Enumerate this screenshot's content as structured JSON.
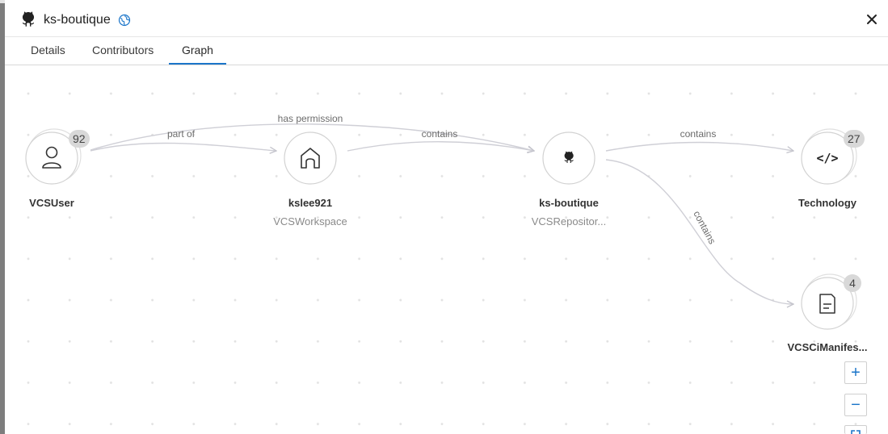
{
  "header": {
    "title": "ks-boutique",
    "repo_icon": "github-octocat-icon",
    "visibility_icon": "globe-icon",
    "close_icon": "close-icon"
  },
  "tabs": [
    {
      "label": "Details",
      "active": false
    },
    {
      "label": "Contributors",
      "active": false
    },
    {
      "label": "Graph",
      "active": true
    }
  ],
  "graph": {
    "nodes": [
      {
        "id": "vcsuser",
        "label": "VCSUser",
        "sublabel": "",
        "badge": "92",
        "icon": "user-icon"
      },
      {
        "id": "kslee921",
        "label": "kslee921",
        "sublabel": "VCSWorkspace",
        "badge": "",
        "icon": "home-icon"
      },
      {
        "id": "ks-boutique",
        "label": "ks-boutique",
        "sublabel": "VCSRepositor...",
        "badge": "",
        "icon": "github-octocat-icon"
      },
      {
        "id": "technology",
        "label": "Technology",
        "sublabel": "",
        "badge": "27",
        "icon": "code-icon"
      },
      {
        "id": "manifest",
        "label": "VCSCiManifes...",
        "sublabel": "",
        "badge": "4",
        "icon": "document-icon"
      }
    ],
    "edges": [
      {
        "from": "vcsuser",
        "to": "kslee921",
        "label": "part of"
      },
      {
        "from": "vcsuser",
        "to": "ks-boutique",
        "label": "has permission"
      },
      {
        "from": "kslee921",
        "to": "ks-boutique",
        "label": "contains"
      },
      {
        "from": "ks-boutique",
        "to": "technology",
        "label": "contains"
      },
      {
        "from": "ks-boutique",
        "to": "manifest",
        "label": "contains"
      }
    ]
  },
  "zoom": {
    "zoom_in": "+",
    "zoom_out": "−"
  },
  "colors": {
    "accent": "#1b75c9",
    "edge": "#c9c9cf",
    "badge_bg": "#d8d8d8"
  }
}
